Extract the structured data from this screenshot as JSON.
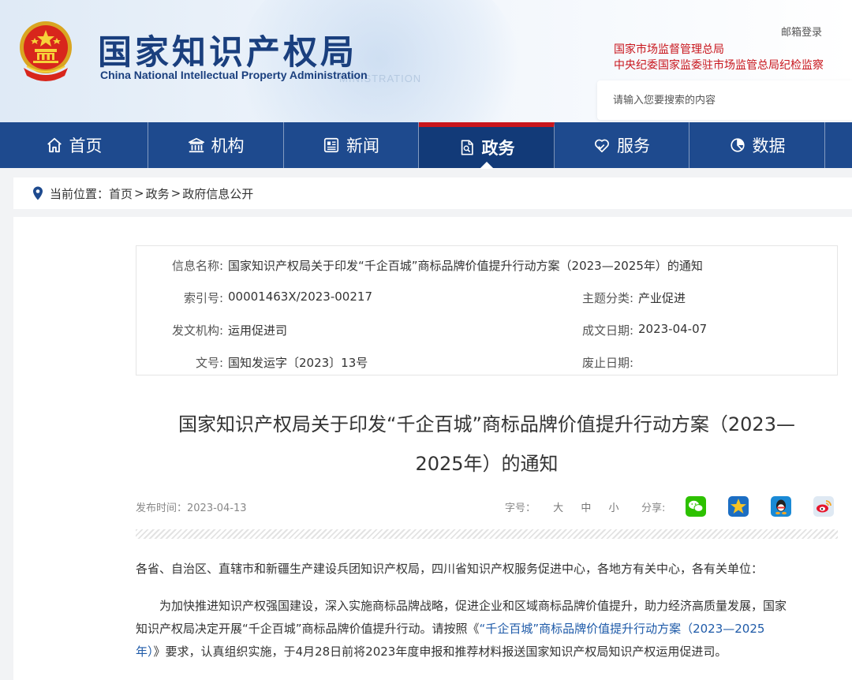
{
  "header": {
    "title_cn": "国家知识产权局",
    "title_en": "China National Intellectual Property Administration",
    "watermark": "MINISTRATION",
    "mail_login": "邮箱登录",
    "links": [
      "国家市场监督管理总局",
      "中央纪委国家监委驻市场监管总局纪检监察"
    ],
    "search_placeholder": "请输入您要搜索的内容"
  },
  "nav": {
    "items": [
      {
        "label": "首页",
        "icon": "home-icon"
      },
      {
        "label": "机构",
        "icon": "institution-icon"
      },
      {
        "label": "新闻",
        "icon": "news-icon"
      },
      {
        "label": "政务",
        "icon": "government-affairs-icon",
        "active": true
      },
      {
        "label": "服务",
        "icon": "service-icon"
      },
      {
        "label": "数据",
        "icon": "data-icon"
      }
    ]
  },
  "breadcrumb": {
    "prefix": "当前位置：",
    "items": [
      "首页",
      "政务",
      "政府信息公开"
    ],
    "separator": ">"
  },
  "info": {
    "name_label": "信息名称:",
    "name_value": "国家知识产权局关于印发“千企百城”商标品牌价值提升行动方案（2023—2025年）的通知",
    "index_label": "索引号:",
    "index_value": "00001463X/2023-00217",
    "topic_label": "主题分类:",
    "topic_value": "产业促进",
    "org_label": "发文机构:",
    "org_value": "运用促进司",
    "date_label": "成文日期:",
    "date_value": "2023-04-07",
    "docno_label": "文号:",
    "docno_value": "国知发运字〔2023〕13号",
    "expire_label": "废止日期:",
    "expire_value": ""
  },
  "article": {
    "title_line1": "国家知识产权局关于印发“千企百城”商标品牌价值提升行动方案（2023—",
    "title_line2": "2025年）的通知",
    "publish_time": "发布时间：2023-04-13",
    "font_size_label": "字号：",
    "font_sizes": [
      "大",
      "中",
      "小"
    ],
    "share_label": "分享:",
    "share_targets": [
      "wechat-icon",
      "qzone-icon",
      "qq-icon",
      "weibo-icon"
    ],
    "salutation": "各省、自治区、直辖市和新疆生产建设兵团知识产权局，四川省知识产权服务促进中心，各地方有关中心，各有关单位：",
    "p1_line1": "为加快推进知识产权强国建设，深入实施商标品牌战略，促进企业和区域商标品牌价值提升，助力经济高质量发展，国家",
    "p1_line2_pre": "知识产权局决定开展“千企百城”商标品牌价值提升行动。请按照《",
    "p1_link_a": "“千企百城”商标品牌价值提升行动方案（2023—2025",
    "p1_link_b": "年）",
    "p1_line3_post": "》要求，认真组织实施，于4月28日前将2023年度申报和推荐材料报送国家知识产权局知识产权运用促进司。"
  },
  "colors": {
    "nav_bg": "#1e4a8e",
    "nav_active_bg": "#123a78",
    "accent_red": "#c8161d",
    "title_blue": "#1a3f7e",
    "link_blue": "#1e5aa8"
  }
}
